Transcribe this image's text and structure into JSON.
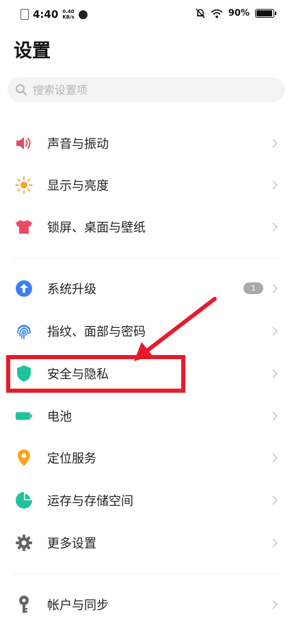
{
  "status_bar": {
    "time": "4:40",
    "speed_value": "0.40",
    "speed_unit": "KB/s",
    "battery": "90%"
  },
  "header": {
    "title": "设置"
  },
  "search": {
    "placeholder": "搜索设置项"
  },
  "groups": [
    {
      "items": [
        {
          "label": "声音与振动",
          "icon": "speaker-icon",
          "color": "#e8475a"
        },
        {
          "label": "显示与亮度",
          "icon": "sun-icon",
          "color": "#f5a623"
        },
        {
          "label": "锁屏、桌面与壁纸",
          "icon": "tshirt-icon",
          "color": "#ea4a62"
        }
      ]
    },
    {
      "items": [
        {
          "label": "系统升级",
          "icon": "upgrade-arrow-icon",
          "color": "#3c7ff0",
          "badge": "1"
        },
        {
          "label": "指纹、面部与密码",
          "icon": "fingerprint-icon",
          "color": "#3c7ff0"
        },
        {
          "label": "安全与隐私",
          "icon": "shield-icon",
          "color": "#1fc39a"
        },
        {
          "label": "电池",
          "icon": "battery-icon",
          "color": "#1fc39a"
        },
        {
          "label": "定位服务",
          "icon": "location-pin-icon",
          "color": "#f5a623"
        },
        {
          "label": "运存与存储空间",
          "icon": "pie-chart-icon",
          "color": "#1fc39a"
        },
        {
          "label": "更多设置",
          "icon": "gear-icon",
          "color": "#666666"
        }
      ]
    },
    {
      "items": [
        {
          "label": "帐户与同步",
          "icon": "key-icon",
          "color": "#666666"
        }
      ]
    }
  ],
  "annotation": {
    "color": "#e51b2c"
  }
}
